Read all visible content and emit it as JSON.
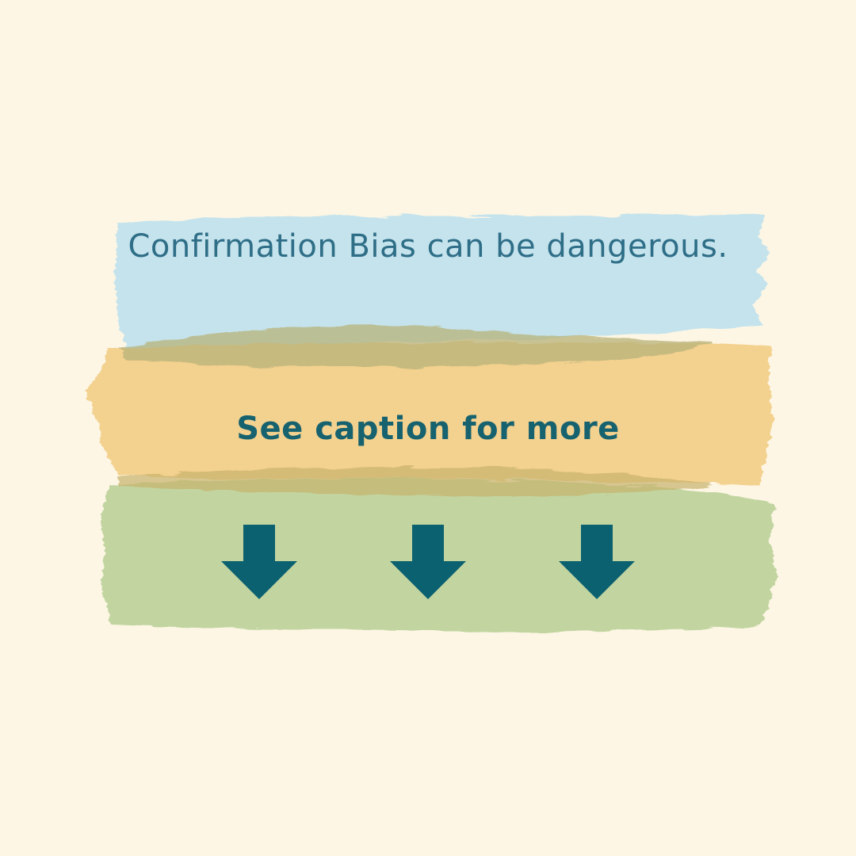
{
  "headline": "Confirmation Bias can be dangerous.",
  "cta": "See caption for more",
  "arrows": [
    "arrow-down-icon",
    "arrow-down-icon",
    "arrow-down-icon"
  ],
  "colors": {
    "background": "#fdf6e4",
    "blue_stroke": "#bfe2ee",
    "orange_stroke": "#f3cd85",
    "green_stroke": "#bfd49e",
    "text": "#2f6d86",
    "arrow": "#0b6170"
  }
}
